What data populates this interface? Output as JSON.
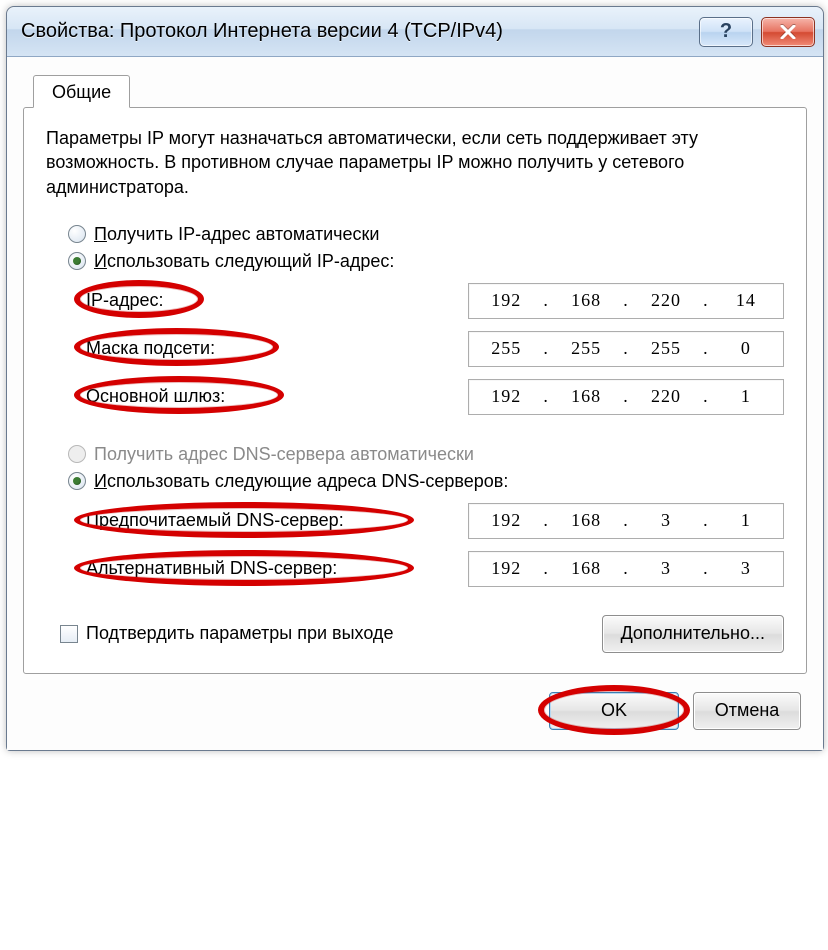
{
  "window": {
    "title": "Свойства: Протокол Интернета версии 4 (TCP/IPv4)"
  },
  "tab": {
    "general": "Общие"
  },
  "description": "Параметры IP могут назначаться автоматически, если сеть поддерживает эту возможность. В противном случае параметры IP можно получить у сетевого администратора.",
  "ip_section": {
    "auto_label": "Получить IP-адрес автоматически",
    "manual_label": "Использовать следующий IP-адрес:",
    "ip_label": "IP-адрес:",
    "mask_label": "Маска подсети:",
    "gateway_label": "Основной шлюз:",
    "ip": [
      "192",
      "168",
      "220",
      "14"
    ],
    "mask": [
      "255",
      "255",
      "255",
      "0"
    ],
    "gateway": [
      "192",
      "168",
      "220",
      "1"
    ]
  },
  "dns_section": {
    "auto_label": "Получить адрес DNS-сервера автоматически",
    "manual_label": "Использовать следующие адреса DNS-серверов:",
    "preferred_label": "Предпочитаемый DNS-сервер:",
    "alternate_label": "Альтернативный DNS-сервер:",
    "preferred": [
      "192",
      "168",
      "3",
      "1"
    ],
    "alternate": [
      "192",
      "168",
      "3",
      "3"
    ]
  },
  "footer": {
    "confirm_on_exit": "Подтвердить параметры при выходе",
    "advanced": "Дополнительно...",
    "ok": "OK",
    "cancel": "Отмена"
  },
  "underline_chars": {
    "ip_auto": "П",
    "ip_manual": "И",
    "dns_auto": "П",
    "dns_manual": "И",
    "mask": "М",
    "gateway": "ш",
    "conf": "т",
    "adv": "Д",
    "cancel": "О"
  }
}
